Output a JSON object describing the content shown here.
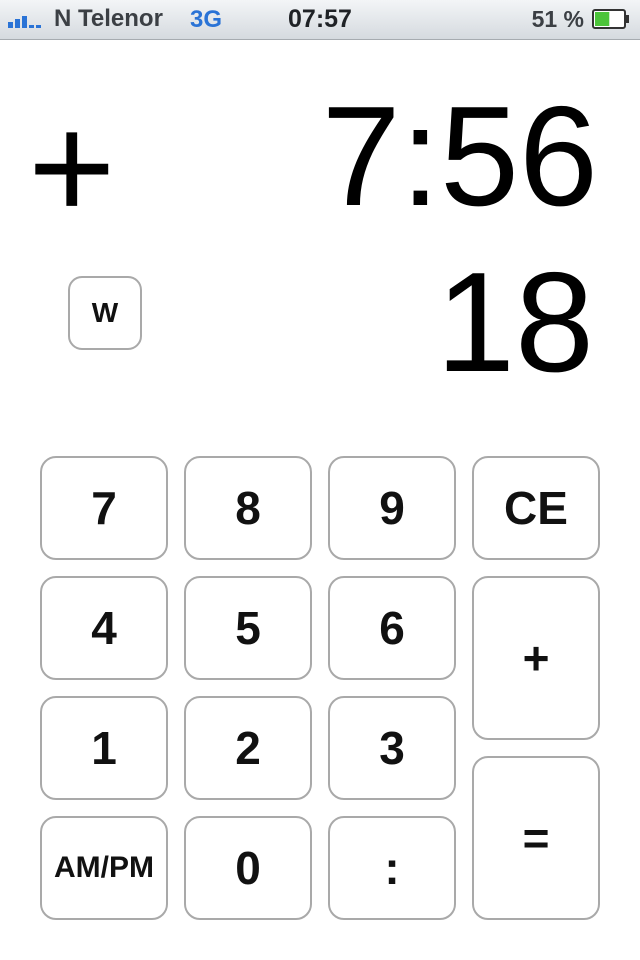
{
  "status_bar": {
    "carrier": "N Telenor",
    "network": "3G",
    "time": "07:57",
    "battery_percent": "51 %",
    "battery_level": 0.51,
    "signal_icon": "signal-bars-icon",
    "battery_icon": "battery-icon"
  },
  "display": {
    "operator": "+",
    "time": "7:56",
    "entry": "18",
    "w_label": "W"
  },
  "keypad": {
    "k7": "7",
    "k8": "8",
    "k9": "9",
    "ce": "CE",
    "k4": "4",
    "k5": "5",
    "k6": "6",
    "plus": "+",
    "k1": "1",
    "k2": "2",
    "k3": "3",
    "ampm": "AM/PM",
    "k0": "0",
    "colon": ":",
    "equals": "="
  },
  "colors": {
    "network": "#2a73d6",
    "battery_fill": "#4cc43a",
    "key_border": "#a9a9a9"
  }
}
